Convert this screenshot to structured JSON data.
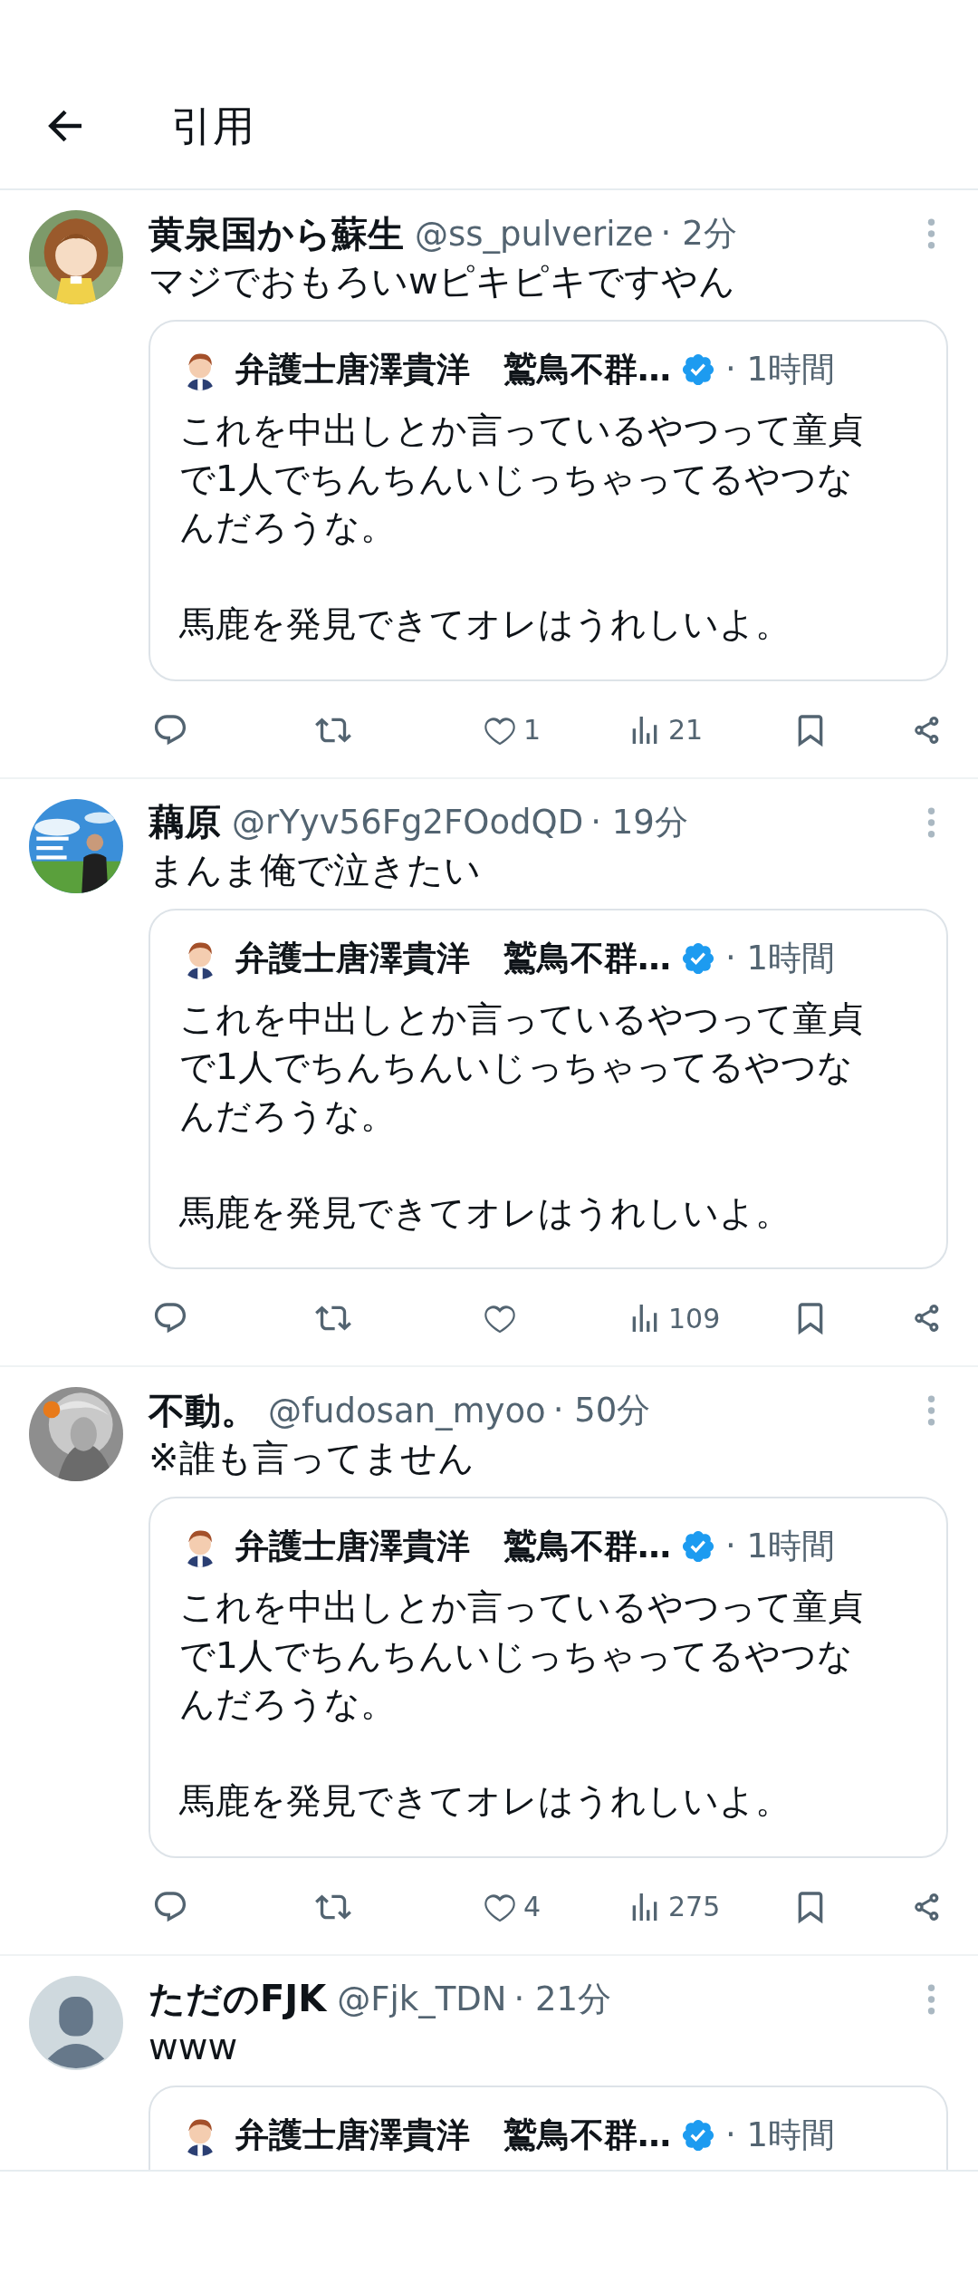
{
  "header": {
    "title": "引用"
  },
  "tweets": [
    {
      "name": "黄泉国から蘇生",
      "handle": "@ss_pulverize",
      "time": "· 2分",
      "text": "マジでおもろいwピキピキですやん",
      "quote": {
        "name": "弁護士唐澤貴洋　鷲鳥不群…",
        "verified": true,
        "time": "· 1時間",
        "paragraphs": [
          "これを中出しとか言っているやつって童貞で1人でちんちんいじっちゃってるやつなんだろうな。",
          "馬鹿を発見できてオレはうれしいよ。"
        ]
      },
      "actions": {
        "likes": "1",
        "views": "21"
      }
    },
    {
      "name": "藕原",
      "handle": "@rYyv56Fg2FOodQD",
      "time": "· 19分",
      "text": "まんま俺で泣きたい",
      "quote": {
        "name": "弁護士唐澤貴洋　鷲鳥不群…",
        "verified": true,
        "time": "· 1時間",
        "paragraphs": [
          "これを中出しとか言っているやつって童貞で1人でちんちんいじっちゃってるやつなんだろうな。",
          "馬鹿を発見できてオレはうれしいよ。"
        ]
      },
      "actions": {
        "views": "109"
      }
    },
    {
      "name": "不動。",
      "handle": "@fudosan_myoo",
      "time": "· 50分",
      "text": "※誰も言ってません",
      "quote": {
        "name": "弁護士唐澤貴洋　鷲鳥不群…",
        "verified": true,
        "time": "· 1時間",
        "paragraphs": [
          "これを中出しとか言っているやつって童貞で1人でちんちんいじっちゃってるやつなんだろうな。",
          "馬鹿を発見できてオレはうれしいよ。"
        ]
      },
      "actions": {
        "likes": "4",
        "views": "275"
      }
    },
    {
      "avatar": {
        "kind": "default"
      },
      "name": "ただのFJK",
      "handle": "@Fjk_TDN",
      "time": "· 21分",
      "text": "www",
      "quote": {
        "name": "弁護士唐澤貴洋　鷲鳥不群…",
        "verified": true,
        "time": "· 1時間"
      }
    }
  ]
}
